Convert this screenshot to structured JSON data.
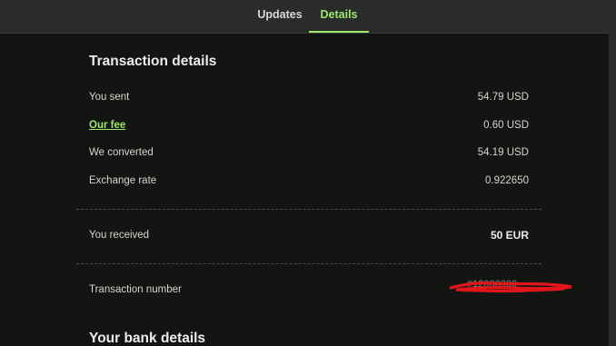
{
  "tabs": [
    {
      "label": "Updates"
    },
    {
      "label": "Details"
    }
  ],
  "transaction_details": {
    "title": "Transaction details",
    "rows": [
      {
        "label": "You sent",
        "value": "54.79 USD"
      },
      {
        "label": "Our fee",
        "value": "0.60 USD"
      },
      {
        "label": "We converted",
        "value": "54.19 USD"
      },
      {
        "label": "Exchange rate",
        "value": "0.922650"
      }
    ],
    "received": {
      "label": "You received",
      "value": "50 EUR"
    },
    "transaction_number": {
      "label": "Transaction number",
      "value": "#12000000"
    }
  },
  "bank_details": {
    "title": "Your bank details"
  },
  "colors": {
    "accent": "#9fe870",
    "background": "#121511",
    "tabbar": "#2a2c2a",
    "redaction": "#e0161b"
  },
  "icons": []
}
